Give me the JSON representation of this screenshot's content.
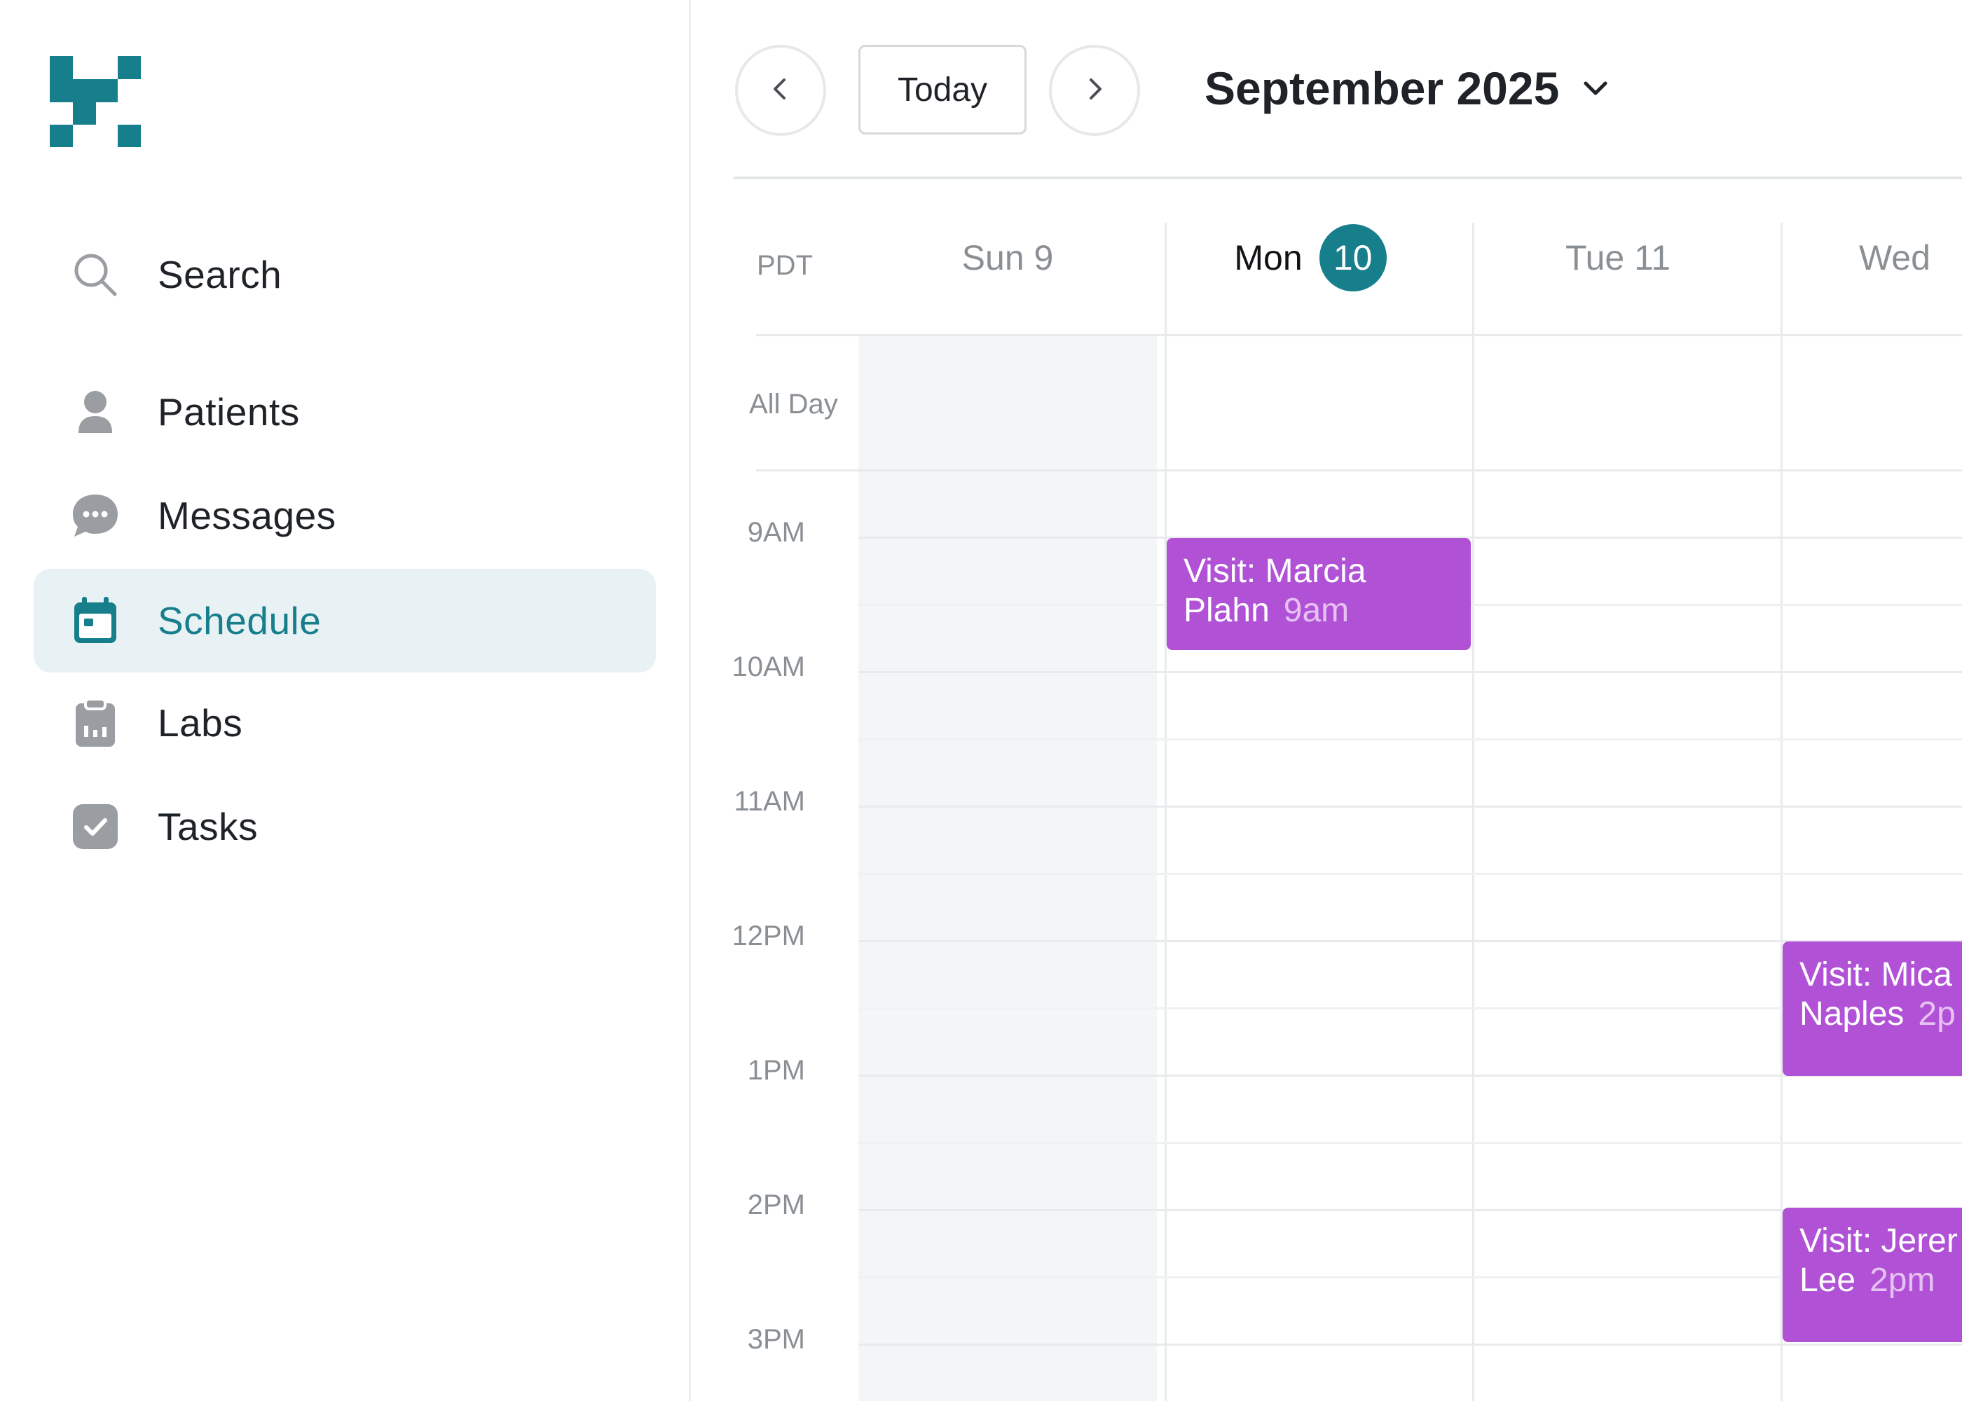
{
  "sidebar": {
    "logo": "logo-icon",
    "items": [
      {
        "label": "Search",
        "icon": "search-icon",
        "active": false
      },
      {
        "label": "Patients",
        "icon": "person-icon",
        "active": false
      },
      {
        "label": "Messages",
        "icon": "chat-bubble-icon",
        "active": false
      },
      {
        "label": "Schedule",
        "icon": "calendar-icon",
        "active": true
      },
      {
        "label": "Labs",
        "icon": "clipboard-chart-icon",
        "active": false
      },
      {
        "label": "Tasks",
        "icon": "checkbox-icon",
        "active": false
      }
    ]
  },
  "toolbar": {
    "prev_icon": "chevron-left-icon",
    "today_label": "Today",
    "next_icon": "chevron-right-icon",
    "month_title": "September 2025",
    "month_dropdown_icon": "chevron-down-icon"
  },
  "calendar": {
    "timezone": "PDT",
    "all_day_label": "All Day",
    "days": [
      {
        "label": "Sun 9",
        "is_today": false
      },
      {
        "label": "Mon",
        "badge": "10",
        "is_today": true
      },
      {
        "label": "Tue 11",
        "is_today": false
      },
      {
        "label": "Wed",
        "is_today": false
      }
    ],
    "hours": [
      "9AM",
      "10AM",
      "11AM",
      "12PM",
      "1PM",
      "2PM",
      "3PM"
    ],
    "events": [
      {
        "title_line1": "Visit: Marcia",
        "title_line2": "Plahn",
        "time": "9am"
      },
      {
        "title_line1": "Visit: Mica",
        "title_line2": "Naples",
        "time": "2p"
      },
      {
        "title_line1": "Visit: Jerer",
        "title_line2": "Lee",
        "time": "2pm"
      }
    ]
  },
  "colors": {
    "accent": "#177f8c",
    "active_bg": "#e8f2f4",
    "event": "#b152d6",
    "event_time": "#e6c2f2",
    "weekend_shade": "#f3f6f7"
  }
}
